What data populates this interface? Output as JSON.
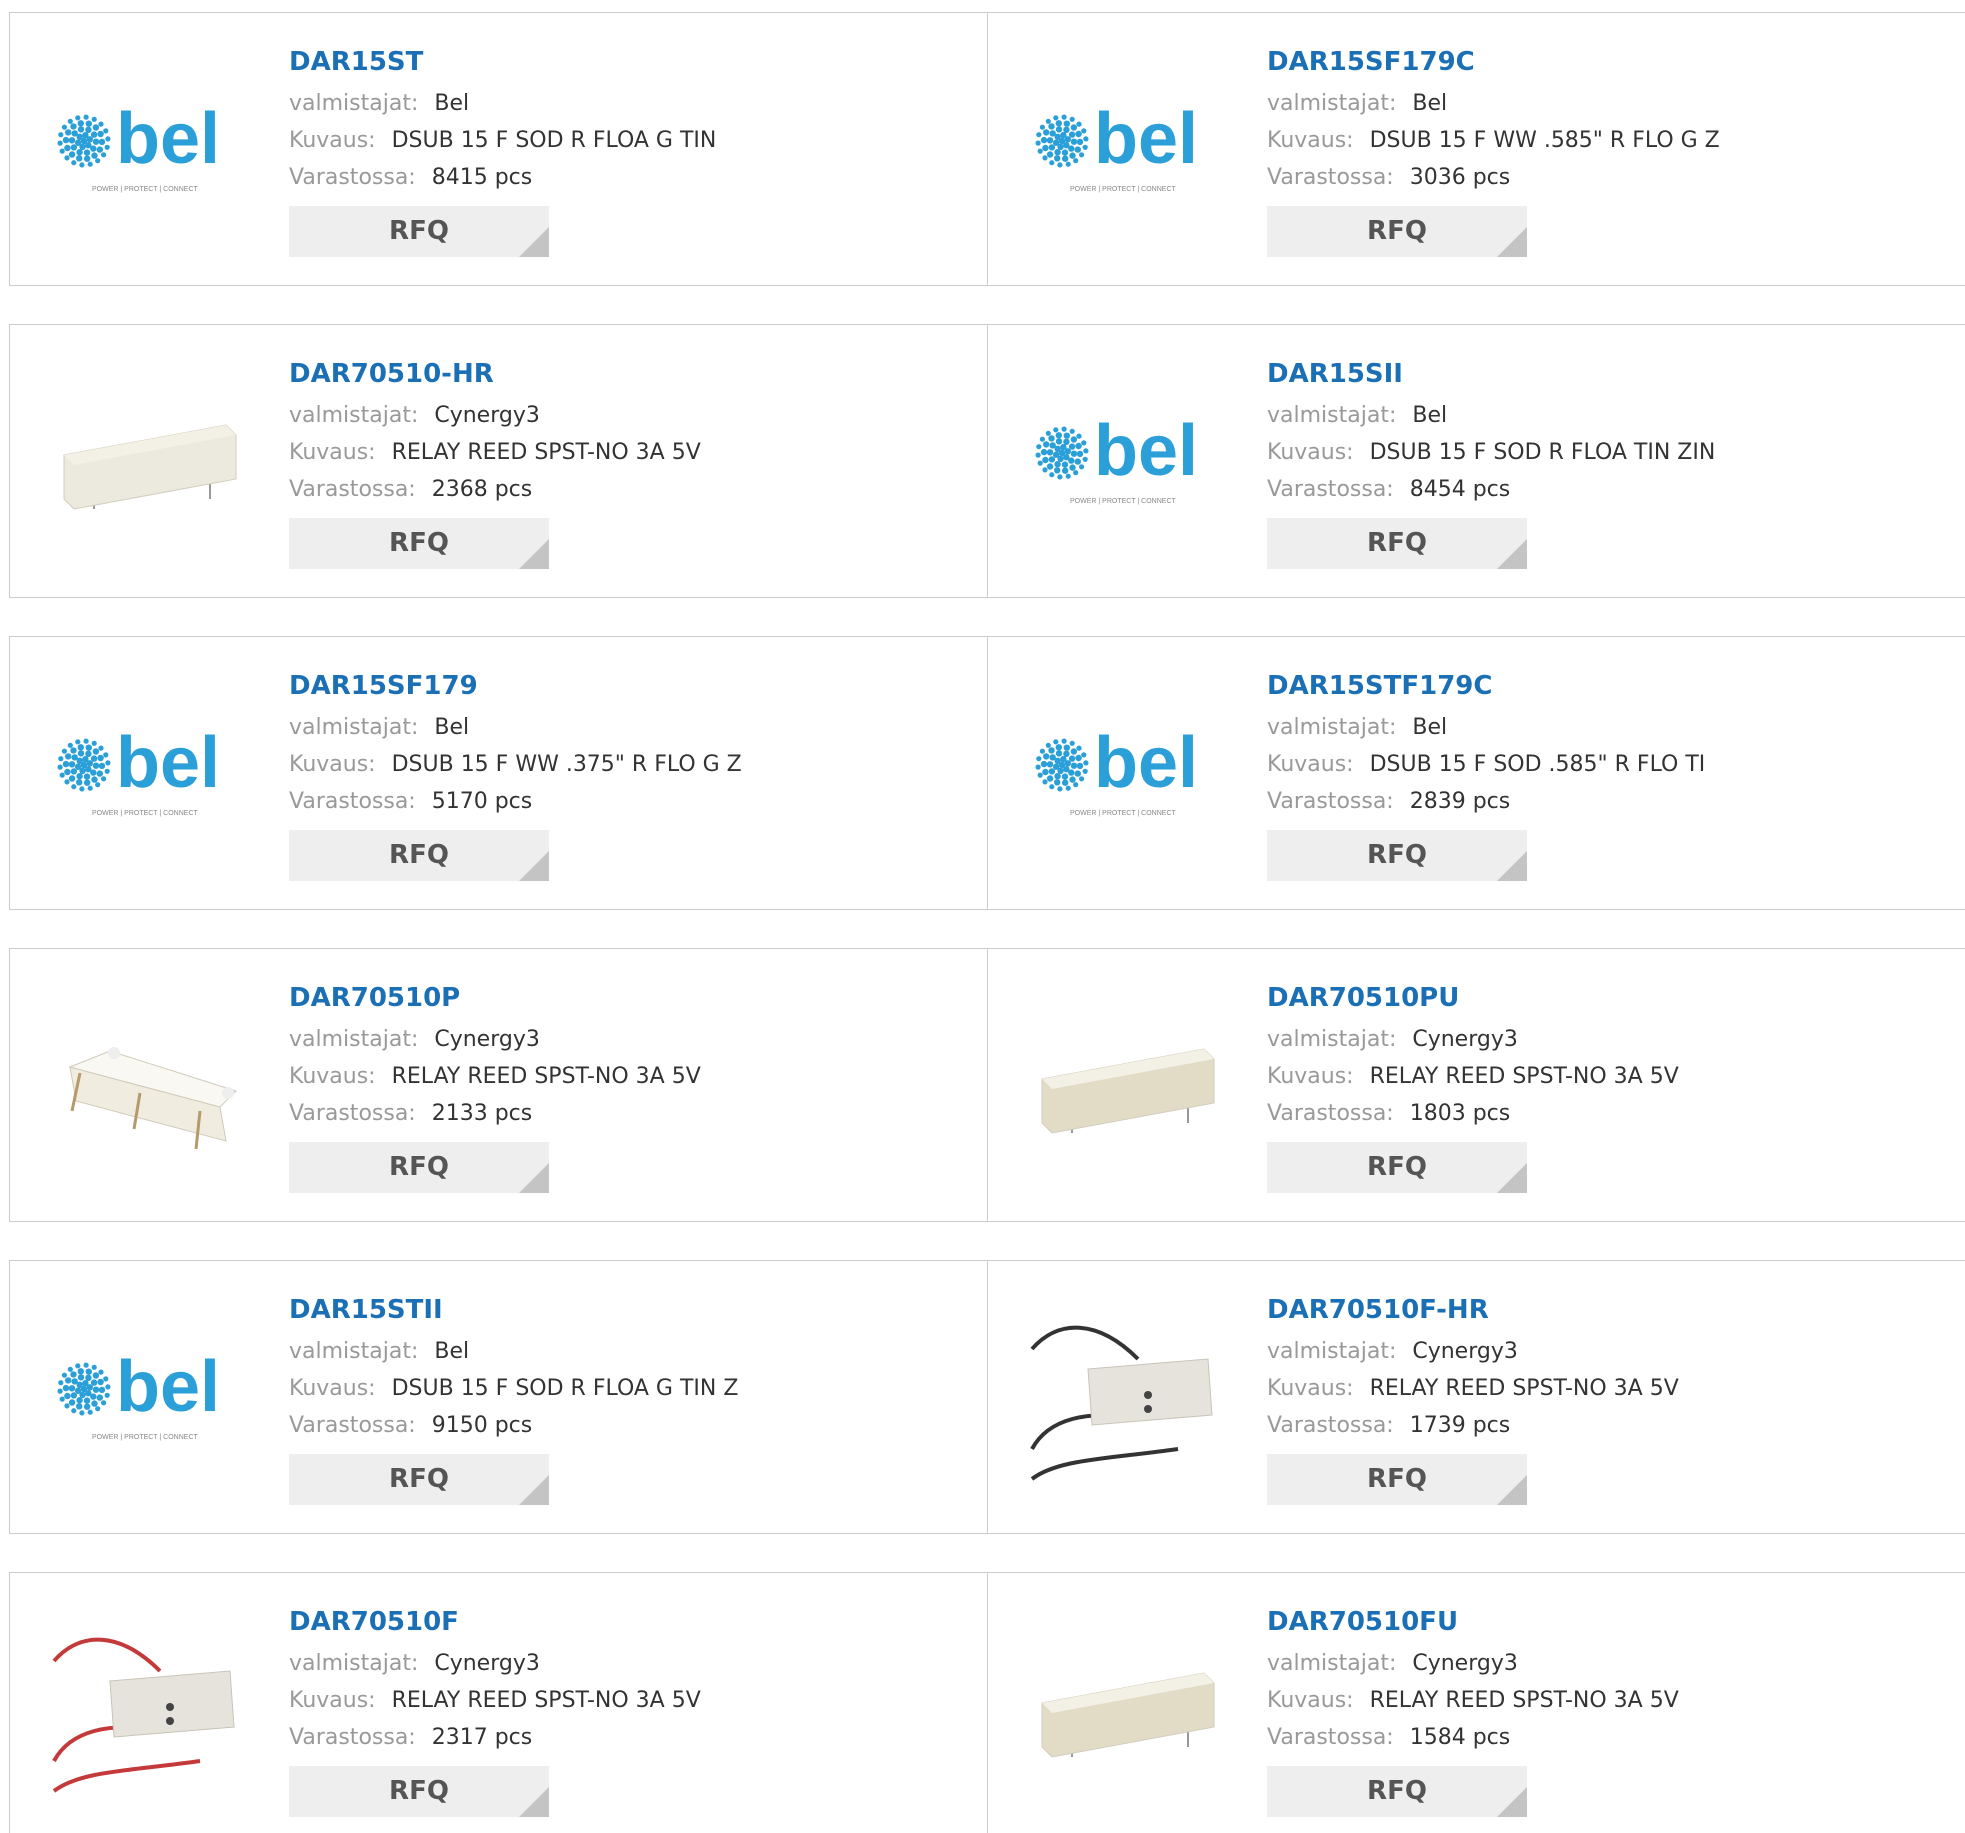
{
  "labels": {
    "manufacturer": "valmistajat:",
    "description": "Kuvaus:",
    "stock": "Varastossa:",
    "rfq": "RFQ"
  },
  "colors": {
    "link": "#1a6fb5",
    "bel_blue": "#2a9fd8",
    "border": "#cccccc",
    "button_bg": "#eeeeee"
  },
  "products": [
    {
      "part": "DAR15ST",
      "manufacturer": "Bel",
      "description": "DSUB 15 F SOD R FLOA G TIN",
      "stock": "8415 pcs",
      "image": "bel-logo"
    },
    {
      "part": "DAR15SF179C",
      "manufacturer": "Bel",
      "description": "DSUB 15 F WW .585\" R FLO G Z",
      "stock": "3036 pcs",
      "image": "bel-logo"
    },
    {
      "part": "DAR70510-HR",
      "manufacturer": "Cynergy3",
      "description": "RELAY REED SPST-NO 3A 5V",
      "stock": "2368 pcs",
      "image": "relay-block"
    },
    {
      "part": "DAR15SII",
      "manufacturer": "Bel",
      "description": "DSUB 15 F SOD R FLOA TIN ZIN",
      "stock": "8454 pcs",
      "image": "bel-logo"
    },
    {
      "part": "DAR15SF179",
      "manufacturer": "Bel",
      "description": "DSUB 15 F WW .375\" R FLO G Z",
      "stock": "5170 pcs",
      "image": "bel-logo"
    },
    {
      "part": "DAR15STF179C",
      "manufacturer": "Bel",
      "description": "DSUB 15 F SOD .585\" R FLO TI",
      "stock": "2839 pcs",
      "image": "bel-logo"
    },
    {
      "part": "DAR70510P",
      "manufacturer": "Cynergy3",
      "description": "RELAY REED SPST-NO 3A 5V",
      "stock": "2133 pcs",
      "image": "relay-pins"
    },
    {
      "part": "DAR70510PU",
      "manufacturer": "Cynergy3",
      "description": "RELAY REED SPST-NO 3A 5V",
      "stock": "1803 pcs",
      "image": "relay-block-tan"
    },
    {
      "part": "DAR15STII",
      "manufacturer": "Bel",
      "description": "DSUB 15 F SOD R FLOA G TIN Z",
      "stock": "9150 pcs",
      "image": "bel-logo"
    },
    {
      "part": "DAR70510F-HR",
      "manufacturer": "Cynergy3",
      "description": "RELAY REED SPST-NO 3A 5V",
      "stock": "1739 pcs",
      "image": "relay-black-wires"
    },
    {
      "part": "DAR70510F",
      "manufacturer": "Cynergy3",
      "description": "RELAY REED SPST-NO 3A 5V",
      "stock": "2317 pcs",
      "image": "relay-red-wires"
    },
    {
      "part": "DAR70510FU",
      "manufacturer": "Cynergy3",
      "description": "RELAY REED SPST-NO 3A 5V",
      "stock": "1584 pcs",
      "image": "relay-block-tan"
    }
  ]
}
